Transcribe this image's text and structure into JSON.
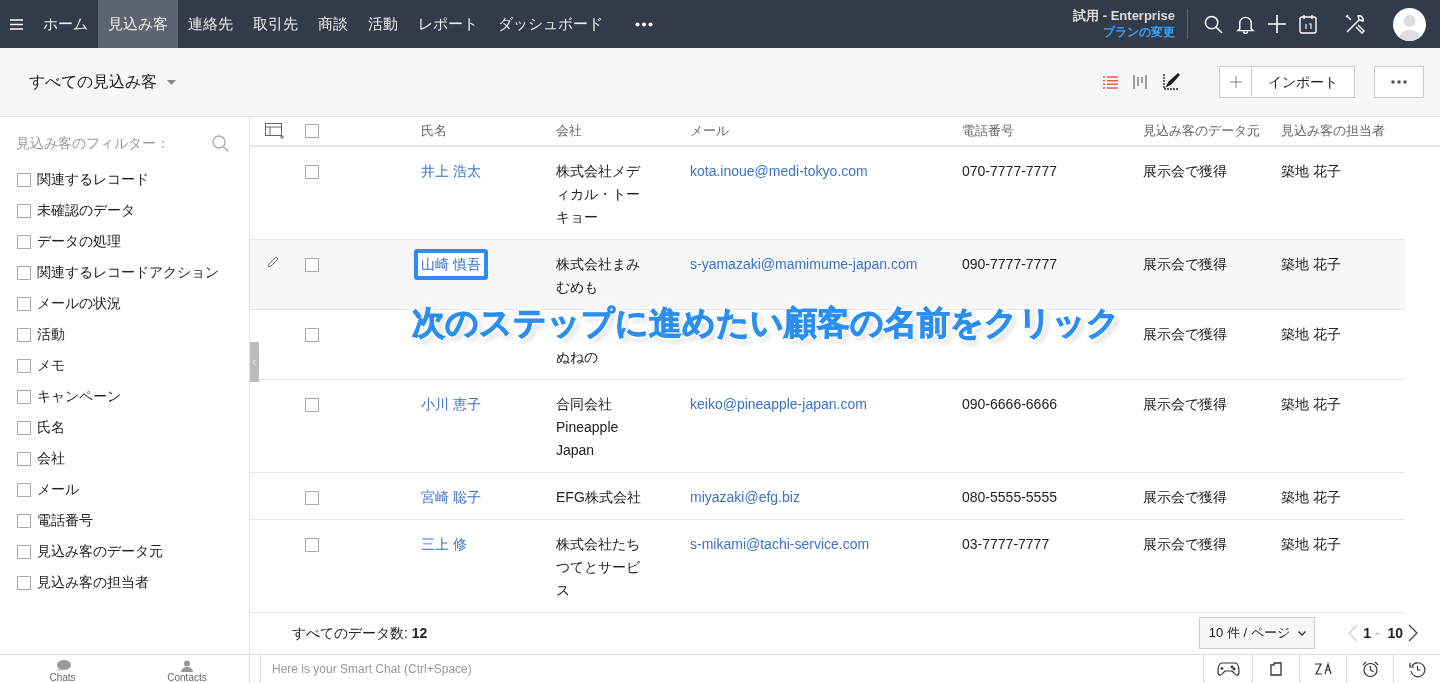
{
  "nav": {
    "tabs": [
      {
        "label": "ホーム",
        "selected": false
      },
      {
        "label": "見込み客",
        "selected": true
      },
      {
        "label": "連絡先",
        "selected": false
      },
      {
        "label": "取引先",
        "selected": false
      },
      {
        "label": "商談",
        "selected": false
      },
      {
        "label": "活動",
        "selected": false
      },
      {
        "label": "レポート",
        "selected": false
      },
      {
        "label": "ダッシュボード",
        "selected": false
      }
    ],
    "plan": "試用 - Enterprise",
    "plan_link": "プランの変更"
  },
  "toolbar": {
    "view": "すべての見込み客",
    "import_button": "インポート"
  },
  "filters": {
    "title": "見込み客のフィルター：",
    "items": [
      {
        "label": "関連するレコード",
        "checked": false
      },
      {
        "label": "未確認のデータ",
        "checked": false
      },
      {
        "label": "データの処理",
        "checked": false
      },
      {
        "label": "関連するレコードアクション",
        "checked": false
      },
      {
        "label": "メールの状況",
        "checked": false
      },
      {
        "label": "活動",
        "checked": false
      },
      {
        "label": "メモ",
        "checked": false
      },
      {
        "label": "キャンペーン",
        "checked": false
      },
      {
        "label": "氏名",
        "checked": false
      },
      {
        "label": "会社",
        "checked": false
      },
      {
        "label": "メール",
        "checked": false
      },
      {
        "label": "電話番号",
        "checked": false
      },
      {
        "label": "見込み客のデータ元",
        "checked": false
      },
      {
        "label": "見込み客の担当者",
        "checked": false
      }
    ]
  },
  "table": {
    "columns": [
      "氏名",
      "会社",
      "メール",
      "電話番号",
      "見込み客のデータ元",
      "見込み客の担当者"
    ],
    "select_all_checked": false,
    "rows": [
      {
        "name": "井上 浩太",
        "company": "株式会社メディカル・トーキョー",
        "email": "kota.inoue@medi-tokyo.com",
        "phone": "070-7777-7777",
        "source": "展示会で獲得",
        "owner": "築地 花子",
        "checked": false,
        "hovered": false,
        "framed": false
      },
      {
        "name": "山崎 慎吾",
        "company": "株式会社まみむめも",
        "email": "s-yamazaki@mamimume-japan.com",
        "phone": "090-7777-7777",
        "source": "展示会で獲得",
        "owner": "築地 花子",
        "checked": false,
        "hovered": true,
        "framed": true
      },
      {
        "company": "ぬねの",
        "first_line_covered": true,
        "source": "展示会で獲得",
        "owner": "築地 花子",
        "checked": false,
        "hovered": false
      },
      {
        "name": "小川 恵子",
        "company": "合同会社Pineapple Japan",
        "email": "keiko@pineapple-japan.com",
        "phone": "090-6666-6666",
        "source": "展示会で獲得",
        "owner": "築地 花子",
        "checked": false,
        "hovered": false,
        "framed": false
      },
      {
        "name": "宮崎 聡子",
        "company": "EFG株式会社",
        "email": "miyazaki@efg.biz",
        "phone": "080-5555-5555",
        "source": "展示会で獲得",
        "owner": "築地 花子",
        "checked": false,
        "hovered": false,
        "framed": false
      },
      {
        "name": "三上 修",
        "company": "株式会社たちつてとサービス",
        "email": "s-mikami@tachi-service.com",
        "phone": "03-7777-7777",
        "source": "展示会で獲得",
        "owner": "築地 花子",
        "checked": false,
        "hovered": false,
        "framed": false
      }
    ],
    "total_label": "すべてのデータ数:",
    "total": "12",
    "page_size": "10 件 / ページ",
    "range_start": "1",
    "range_sep": "-",
    "range_end": "10"
  },
  "annotation": "次のステップに進めたい顧客の名前をクリック",
  "bottom_bar": {
    "chats": "Chats",
    "contacts": "Contacts",
    "chat_placeholder": "Here is your Smart Chat (Ctrl+Space)"
  }
}
